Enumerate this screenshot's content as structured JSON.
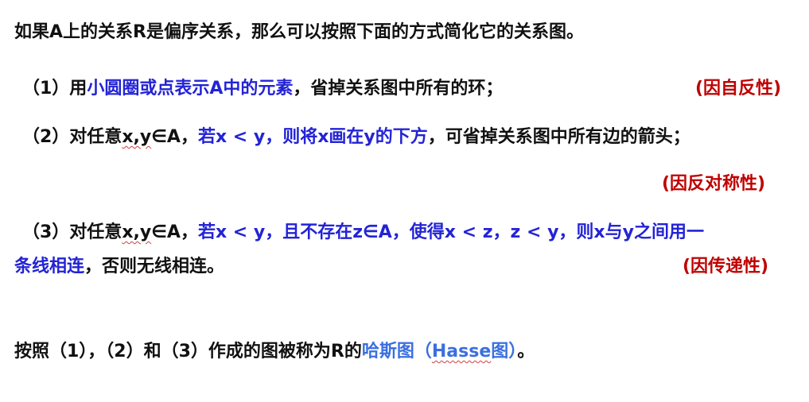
{
  "colors": {
    "text": "#111111",
    "blue": "#2323d6",
    "red": "#c00000",
    "light_blue": "#3b6fe0",
    "wavy_underline": "#d04040"
  },
  "intro": "如果A上的关系R是偏序关系，那么可以按照下面的方式简化它的关系图。",
  "rule1": {
    "prefix": "（1）用",
    "blue": "小圆圈或点表示A中的元素",
    "suffix": "，省掉关系图中所有的环；",
    "property": "(因自反性)"
  },
  "rule2": {
    "prefix": "（2）对任意",
    "vars": "x,y",
    "in_a": "∈A，",
    "blue": "若x < y，则将x画在y的下方",
    "suffix": "，可省掉关系图中所有边的箭头；",
    "property": "(因反对称性)"
  },
  "rule3": {
    "prefix": "（3）对任意",
    "vars": "x,y",
    "in_a": "∈A，",
    "blue_line1": "若x < y，且不存在z∈A，使得x < z，z < y，则x与y之间用一",
    "blue_line2": "条线相连",
    "suffix": "，否则无线相连。",
    "property": "(因传递性)"
  },
  "summary": {
    "prefix": "按照（1），（2）和（3）作成的图被称为R的",
    "term": "哈斯图（",
    "term_hasse": "Hasse",
    "term_end": "图）",
    "end": "。"
  }
}
